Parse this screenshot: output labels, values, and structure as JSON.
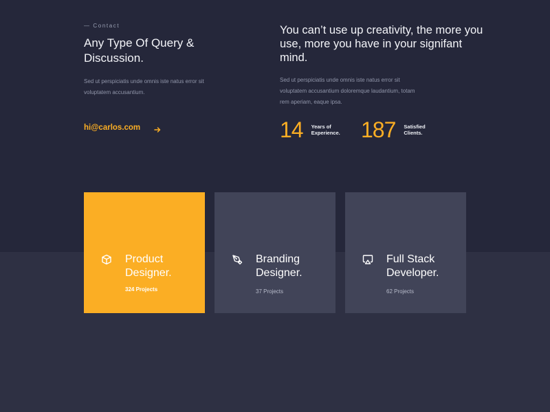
{
  "contact": {
    "eyebrow": "— Contact",
    "title": "Any Type Of Query & Discussion.",
    "description": "Sed ut perspiciatis unde omnis iste natus error sit voluptatem accusantium.",
    "email": "hi@carlos.com",
    "arrow_icon": "arrow-right-icon"
  },
  "about": {
    "quote": "You can’t use up creativity, the more you use, more you have in your signifant mind.",
    "description": "Sed ut perspiciatis unde omnis iste natus error sit voluptatem accusantium doloremque laudantium, totam rem aperiam, eaque ipsa.",
    "stats": [
      {
        "number": "14",
        "label": "Years of Experience."
      },
      {
        "number": "187",
        "label": "Satisfied Clients."
      }
    ]
  },
  "services": [
    {
      "icon": "cube-icon",
      "title": "Product Designer.",
      "count": "324 Projects",
      "highlight": true
    },
    {
      "icon": "pen-tool-icon",
      "title": "Branding Designer.",
      "count": "37 Projects",
      "highlight": false
    },
    {
      "icon": "airplay-icon",
      "title": "Full Stack Developer.",
      "count": "62 Projects",
      "highlight": false
    }
  ],
  "colors": {
    "accent": "#fbae24",
    "background_top": "#25273a",
    "background_bottom": "#2e3043",
    "card": "#414458"
  }
}
